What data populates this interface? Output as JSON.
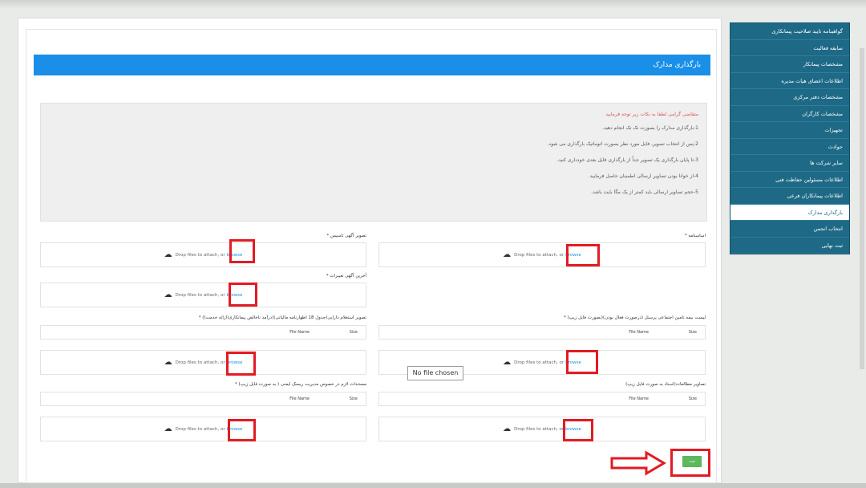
{
  "header": {
    "title": "بارگذاری مدارک"
  },
  "info": {
    "title": "متقاضی گرامی لطفا به نکات زیر توجه فرمایید",
    "items": [
      "1-بارگذاری مدارک را بصورت تک تک انجام دهید.",
      "2-پس از انتخاب تصویر، فایل مورد نظر بصورت اتوماتیک بارگذاری می شود.",
      "3-تا پایان بارگذاری یک تصویر جداً از بارگذاری فایل بعدی خودداری کنید.",
      "4-از خوانا بودن تصاویر ارسالی اطمینان حاصل فرمایید.",
      "5-حجم تصاویر ارسالی باید کمتر از یک مگا بایت باشد."
    ]
  },
  "upload": {
    "drop_text": "Drop files to attach, or",
    "browse_text": "browse",
    "file_name_header": "File Name",
    "size_header": "Size"
  },
  "fields": {
    "asasnameh": "اساسنامه *",
    "agahi_tasis": "تصویر آگهی تاسیس *",
    "akharin_agahi": "آخرین آگهی تغییرات *",
    "bimeh_list": "لیست بیمه تامین اجتماعی پرسنل (درصورت فعال بودن)(بصورت فایل زیپ) *",
    "estelam_darayi": "تصویر استعلام دارایی(جدول 18 اظهارنامه مالیاتی)(درآمد ناخالص پیمانکاری(ارائه خدمت)) *",
    "mostanadat_risk": "مستندات لازم در خصوص مدیریت ریسک ایمنی ( به صورت فایل زیپ) *",
    "tasavir_motaleat": "تصاویر مطالعات(اسناد به صورت فایل زیپ)"
  },
  "tooltip": "No file chosen",
  "submit_label": "ثبت",
  "sidebar": {
    "items": [
      {
        "label": "گواهینامه تایید صلاحیت پیمانکاری"
      },
      {
        "label": "سابقه فعالیت"
      },
      {
        "label": "مشخصات پیمانکار"
      },
      {
        "label": "اطلاعات اعضای هیات مدیره"
      },
      {
        "label": "مشخصات دفتر مرکزی"
      },
      {
        "label": "مشخصات کارگران"
      },
      {
        "label": "تجهیزات"
      },
      {
        "label": "حوادث"
      },
      {
        "label": "سایر شرکت ها"
      },
      {
        "label": "اطلاعات مسئولین حفاظت فنی"
      },
      {
        "label": "اطلاعات پیمانکاران فرعی"
      },
      {
        "label": "بارگذاری مدارک"
      },
      {
        "label": "انتخاب انجمن"
      },
      {
        "label": "ثبت نهایی"
      }
    ]
  },
  "colors": {
    "header": "#1a8fe8",
    "sidebar": "#1e6a86",
    "highlight": "#e21b23",
    "submit": "#5cb85c"
  }
}
